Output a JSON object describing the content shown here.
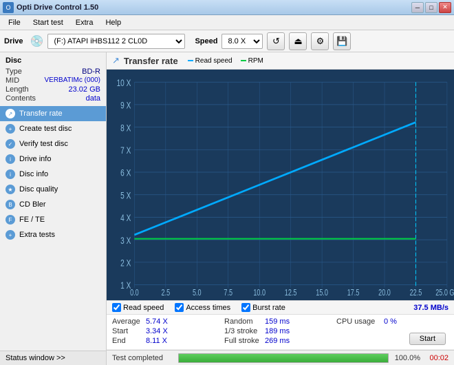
{
  "titleBar": {
    "title": "Opti Drive Control 1.50",
    "minBtn": "─",
    "maxBtn": "□",
    "closeBtn": "✕"
  },
  "menuBar": {
    "items": [
      "File",
      "Start test",
      "Extra",
      "Help"
    ]
  },
  "driveBar": {
    "driveLabel": "Drive",
    "driveValue": "(F:)  ATAPI iHBS112  2 CL0D",
    "speedLabel": "Speed",
    "speedValue": "8.0 X"
  },
  "sidebar": {
    "discTitle": "Disc",
    "discInfo": [
      {
        "key": "Type",
        "val": "BD-R"
      },
      {
        "key": "MID",
        "val": "VERBATIMc (000)"
      },
      {
        "key": "Length",
        "val": "23.02 GB"
      },
      {
        "key": "Contents",
        "val": "data"
      }
    ],
    "navItems": [
      {
        "id": "transfer-rate",
        "label": "Transfer rate",
        "active": true
      },
      {
        "id": "create-test-disc",
        "label": "Create test disc",
        "active": false
      },
      {
        "id": "verify-test-disc",
        "label": "Verify test disc",
        "active": false
      },
      {
        "id": "drive-info",
        "label": "Drive info",
        "active": false
      },
      {
        "id": "disc-info",
        "label": "Disc info",
        "active": false
      },
      {
        "id": "disc-quality",
        "label": "Disc quality",
        "active": false
      },
      {
        "id": "cd-bler",
        "label": "CD Bler",
        "active": false
      },
      {
        "id": "fe-te",
        "label": "FE / TE",
        "active": false
      },
      {
        "id": "extra-tests",
        "label": "Extra tests",
        "active": false
      }
    ],
    "statusBtn": "Status window >>"
  },
  "chart": {
    "title": "Transfer rate",
    "legend": {
      "readLabel": "Read speed",
      "rpmLabel": "RPM"
    },
    "yAxisLabels": [
      "10 X",
      "9 X",
      "8 X",
      "7 X",
      "6 X",
      "5 X",
      "4 X",
      "3 X",
      "2 X",
      "1 X"
    ],
    "xAxisLabels": [
      "0.0",
      "2.5",
      "5.0",
      "7.5",
      "10.0",
      "12.5",
      "15.0",
      "17.5",
      "20.0",
      "22.5",
      "25.0 GB"
    ]
  },
  "checkboxes": {
    "readSpeed": {
      "label": "Read speed",
      "checked": true
    },
    "accessTimes": {
      "label": "Access times",
      "checked": true
    },
    "burstRate": {
      "label": "Burst rate",
      "checked": true
    },
    "burstVal": "37.5 MB/s"
  },
  "stats": {
    "average": {
      "key": "Average",
      "val": "5.74 X"
    },
    "start": {
      "key": "Start",
      "val": "3.34 X"
    },
    "end": {
      "key": "End",
      "val": "8.11 X"
    },
    "random": {
      "key": "Random",
      "val": "159 ms"
    },
    "stroke13": {
      "key": "1/3 stroke",
      "val": "189 ms"
    },
    "fullStroke": {
      "key": "Full stroke",
      "val": "269 ms"
    },
    "cpuUsage": {
      "key": "CPU usage",
      "val": "0 %"
    },
    "startBtn": "Start"
  },
  "progress": {
    "label": "Test completed",
    "pct": "100.0%",
    "fill": 100,
    "time": "00:02"
  }
}
